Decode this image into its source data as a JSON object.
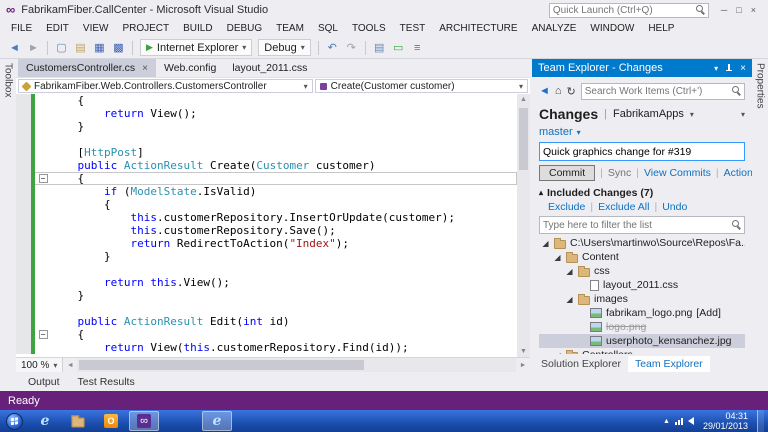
{
  "colors": {
    "accent_blue": "#007acc",
    "status_purple": "#68217a",
    "link_blue": "#0e70c0",
    "keyword": "#0000ff",
    "type": "#2b91af",
    "string": "#a31515",
    "change_green": "#3fa43f",
    "selection": "#cccedb"
  },
  "titlebar": {
    "title": "FabrikamFiber.CallCenter - Microsoft Visual Studio",
    "quick_launch_placeholder": "Quick Launch (Ctrl+Q)"
  },
  "menubar": {
    "items": [
      "FILE",
      "EDIT",
      "VIEW",
      "PROJECT",
      "BUILD",
      "DEBUG",
      "TEAM",
      "SQL",
      "TOOLS",
      "TEST",
      "ARCHITECTURE",
      "ANALYZE",
      "WINDOW",
      "HELP"
    ]
  },
  "toolbar": {
    "run_target": "Internet Explorer",
    "configuration": "Debug",
    "play_glyph": "▶",
    "items": [
      {
        "kind": "icon",
        "name": "back-icon",
        "glyph": "◄",
        "color": "#4a7ac0"
      },
      {
        "kind": "icon",
        "name": "forward-icon",
        "glyph": "►",
        "color": "#a0a0a8"
      },
      {
        "kind": "sep"
      },
      {
        "kind": "icon",
        "name": "new-file-icon",
        "glyph": "▢",
        "color": "#6b86b5"
      },
      {
        "kind": "icon",
        "name": "open-file-icon",
        "glyph": "▤",
        "color": "#c2a156"
      },
      {
        "kind": "icon",
        "name": "save-icon",
        "glyph": "▦",
        "color": "#3c5fb0"
      },
      {
        "kind": "icon",
        "name": "save-all-icon",
        "glyph": "▩",
        "color": "#3c5fb0"
      },
      {
        "kind": "sep"
      },
      {
        "kind": "run"
      },
      {
        "kind": "config"
      },
      {
        "kind": "sep"
      },
      {
        "kind": "icon",
        "name": "undo-icon",
        "glyph": "↶",
        "color": "#4a7ac0"
      },
      {
        "kind": "icon",
        "name": "redo-icon",
        "glyph": "↷",
        "color": "#a0a0a8"
      },
      {
        "kind": "sep"
      },
      {
        "kind": "icon",
        "name": "find-in-files-icon",
        "glyph": "▤",
        "color": "#6b86b5"
      },
      {
        "kind": "icon",
        "name": "comment-icon",
        "glyph": "▭",
        "color": "#3aa33a"
      },
      {
        "kind": "icon",
        "name": "options-icon",
        "glyph": "≡",
        "color": "#707078"
      }
    ]
  },
  "left_strip": {
    "tab": "Toolbox"
  },
  "right_strip": {
    "tab": "Properties"
  },
  "editor": {
    "tabs": [
      {
        "label": "CustomersController.cs",
        "active": true
      },
      {
        "label": "Web.config",
        "active": false
      },
      {
        "label": "layout_2011.css",
        "active": false
      }
    ],
    "nav_type": "FabrikamFiber.Web.Controllers.CustomersController",
    "nav_member": "Create(Customer customer)",
    "zoom": "100 %",
    "bottom_tabs": [
      "Output",
      "Test Results"
    ],
    "code": [
      {
        "s": [
          [
            "p",
            "    {"
          ]
        ]
      },
      {
        "s": [
          [
            "k",
            "        return"
          ],
          [
            "p",
            " View();"
          ]
        ]
      },
      {
        "s": [
          [
            "p",
            "    }"
          ]
        ]
      },
      {
        "s": []
      },
      {
        "s": [
          [
            "p",
            "    ["
          ],
          [
            "t",
            "HttpPost"
          ],
          [
            "p",
            "]"
          ]
        ]
      },
      {
        "s": [
          [
            "k",
            "    public"
          ],
          [
            "p",
            " "
          ],
          [
            "t",
            "ActionResult"
          ],
          [
            "p",
            " Create("
          ],
          [
            "t",
            "Customer"
          ],
          [
            "p",
            " customer)"
          ]
        ]
      },
      {
        "s": [
          [
            "p",
            "    {"
          ]
        ],
        "fold": true,
        "cur": true
      },
      {
        "s": [
          [
            "k",
            "        if"
          ],
          [
            "p",
            " ("
          ],
          [
            "t",
            "ModelState"
          ],
          [
            "p",
            ".IsValid)"
          ]
        ]
      },
      {
        "s": [
          [
            "p",
            "        {"
          ]
        ]
      },
      {
        "s": [
          [
            "k",
            "            this"
          ],
          [
            "p",
            ".customerRepository.InsertOrUpdate(customer);"
          ]
        ]
      },
      {
        "s": [
          [
            "k",
            "            this"
          ],
          [
            "p",
            ".customerRepository.Save();"
          ]
        ]
      },
      {
        "s": [
          [
            "k",
            "            return"
          ],
          [
            "p",
            " RedirectToAction("
          ],
          [
            "sv",
            "\"Index\""
          ],
          [
            "p",
            ");"
          ]
        ]
      },
      {
        "s": [
          [
            "p",
            "        }"
          ]
        ]
      },
      {
        "s": []
      },
      {
        "s": [
          [
            "k",
            "        return"
          ],
          [
            "p",
            " "
          ],
          [
            "k",
            "this"
          ],
          [
            "p",
            ".View();"
          ]
        ]
      },
      {
        "s": [
          [
            "p",
            "    }"
          ]
        ]
      },
      {
        "s": []
      },
      {
        "s": [
          [
            "k",
            "    public"
          ],
          [
            "p",
            " "
          ],
          [
            "t",
            "ActionResult"
          ],
          [
            "p",
            " Edit("
          ],
          [
            "k",
            "int"
          ],
          [
            "p",
            " id)"
          ]
        ]
      },
      {
        "s": [
          [
            "p",
            "    {"
          ]
        ],
        "fold": true
      },
      {
        "s": [
          [
            "k",
            "        return"
          ],
          [
            "p",
            " View("
          ],
          [
            "k",
            "this"
          ],
          [
            "p",
            ".customerRepository.Find(id));"
          ]
        ]
      }
    ]
  },
  "team_explorer": {
    "title": "Team Explorer - Changes",
    "search_placeholder": "Search Work Items (Ctrl+')",
    "page_title": "Changes",
    "project": "FabrikamApps",
    "branch": "master",
    "comment": "Quick graphics change for #319",
    "actions_row": [
      {
        "label": "Commit",
        "kind": "button"
      },
      {
        "label": "Sync",
        "kind": "muted"
      },
      {
        "label": "View Commits",
        "kind": "link"
      },
      {
        "label": "Actions",
        "kind": "link",
        "chevron": true
      }
    ],
    "section": "Included Changes (7)",
    "section_links": [
      "Exclude",
      "Exclude All",
      "Undo"
    ],
    "filter_placeholder": "Type here to filter the list",
    "tree": [
      {
        "level": 0,
        "arrow": "expanded",
        "icon": "folder",
        "label": "C:\\Users\\martinwo\\Source\\Repos\\Fa..."
      },
      {
        "level": 1,
        "arrow": "expanded",
        "icon": "folder",
        "label": "Content"
      },
      {
        "level": 2,
        "arrow": "expanded",
        "icon": "folder",
        "label": "css"
      },
      {
        "level": 3,
        "arrow": "none",
        "icon": "file",
        "label": "layout_2011.css"
      },
      {
        "level": 2,
        "arrow": "expanded",
        "icon": "folder",
        "label": "images"
      },
      {
        "level": 3,
        "arrow": "none",
        "icon": "image",
        "label": "fabrikam_logo.png",
        "suffix": " [Add]"
      },
      {
        "level": 3,
        "arrow": "none",
        "icon": "image",
        "label": "logo.png",
        "deleted": true
      },
      {
        "level": 3,
        "arrow": "none",
        "icon": "image",
        "label": "userphoto_kensanchez.jpg",
        "selected": true
      },
      {
        "level": 1,
        "arrow": "expanded",
        "icon": "folder",
        "label": "Controllers"
      }
    ],
    "bottom_tabs": [
      {
        "label": "Solution Explorer",
        "active": false
      },
      {
        "label": "Team Explorer",
        "active": true
      }
    ]
  },
  "statusbar": {
    "text": "Ready"
  },
  "taskbar": {
    "time": "04:31",
    "date": "29/01/2013",
    "items": [
      {
        "name": "internet-explorer",
        "kind": "ie"
      },
      {
        "name": "windows-explorer",
        "kind": "folder"
      },
      {
        "name": "outlook",
        "kind": "outlook",
        "label": "O"
      },
      {
        "name": "visual-studio",
        "kind": "vs",
        "glyph": "∞",
        "active": true
      },
      {
        "name": "internet-explorer-window",
        "kind": "ie",
        "separate": true,
        "active": true
      }
    ]
  }
}
